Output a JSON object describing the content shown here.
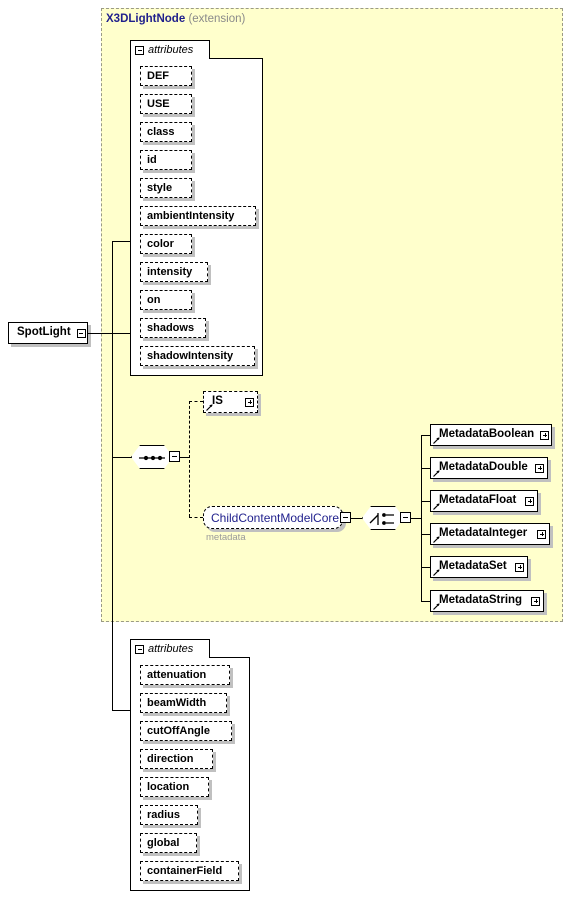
{
  "diagram": {
    "root_element": "SpotLight",
    "extension": {
      "name": "X3DLightNode",
      "kind": "(extension)"
    },
    "attributes_label": "attributes",
    "inherited_attributes": [
      "DEF",
      "USE",
      "class",
      "id",
      "style",
      "ambientIntensity",
      "color",
      "intensity",
      "on",
      "shadows",
      "shadowIntensity"
    ],
    "own_attributes": [
      "attenuation",
      "beamWidth",
      "cutOffAngle",
      "direction",
      "location",
      "radius",
      "global",
      "containerField"
    ],
    "is_element": "IS",
    "content_model": {
      "name": "ChildContentModelCore",
      "sublabel": "metadata"
    },
    "metadata_children": [
      "MetadataBoolean",
      "MetadataDouble",
      "MetadataFloat",
      "MetadataInteger",
      "MetadataSet",
      "MetadataString"
    ],
    "compositors": {
      "sequence": "sequence-compositor",
      "choice": "choice-compositor"
    },
    "colors": {
      "extension_fill": "#ffffcc",
      "extension_border": "#9a9a86",
      "type_text": "#1f1f8c",
      "shadow": "#c0c0c0",
      "sublabel_text": "#9a9a9a"
    }
  }
}
